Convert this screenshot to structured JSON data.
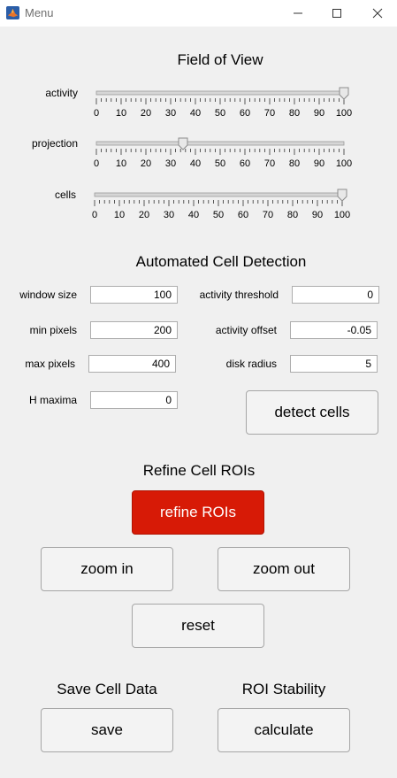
{
  "window": {
    "title": "Menu",
    "icon": "matlab-icon",
    "controls": {
      "minimize": "minimize-icon",
      "maximize": "maximize-icon",
      "close": "close-icon"
    }
  },
  "field_of_view": {
    "heading": "Field of View",
    "ticks": [
      "0",
      "10",
      "20",
      "30",
      "40",
      "50",
      "60",
      "70",
      "80",
      "90",
      "100"
    ],
    "sliders": [
      {
        "label": "activity",
        "value": 100
      },
      {
        "label": "projection",
        "value": 35
      },
      {
        "label": "cells",
        "value": 100
      }
    ]
  },
  "detection": {
    "heading": "Automated Cell Detection",
    "window_size": {
      "label": "window size",
      "value": "100"
    },
    "activity_threshold": {
      "label": "activity threshold",
      "value": "0"
    },
    "min_pixels": {
      "label": "min pixels",
      "value": "200"
    },
    "activity_offset": {
      "label": "activity offset",
      "value": "-0.05"
    },
    "max_pixels": {
      "label": "max pixels",
      "value": "400"
    },
    "disk_radius": {
      "label": "disk radius",
      "value": "5"
    },
    "h_maxima": {
      "label": "H maxima",
      "value": "0"
    },
    "detect_button": "detect cells"
  },
  "refine": {
    "heading": "Refine Cell ROIs",
    "refine_button": "refine ROIs",
    "zoom_in": "zoom in",
    "zoom_out": "zoom out",
    "reset": "reset",
    "accent_color": "#d71a06"
  },
  "save": {
    "heading": "Save Cell Data",
    "button": "save"
  },
  "stability": {
    "heading": "ROI Stability",
    "button": "calculate"
  }
}
